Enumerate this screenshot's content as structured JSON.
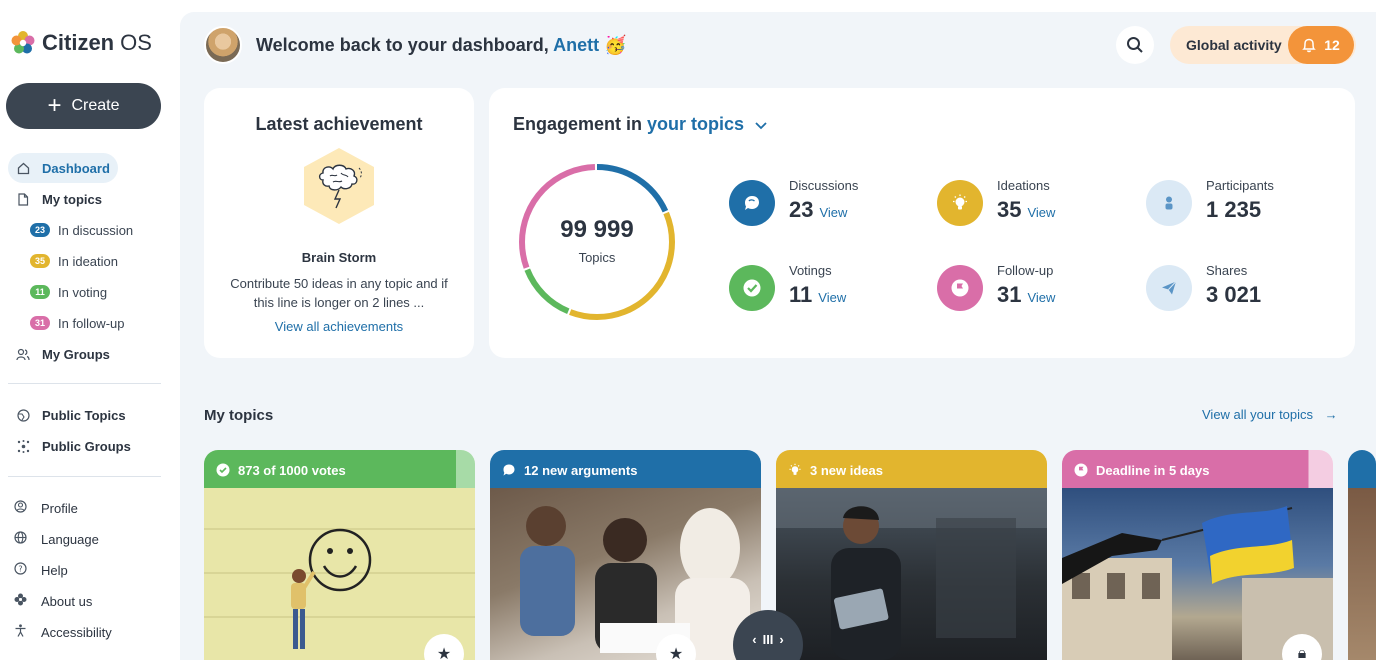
{
  "sidebar": {
    "logo": {
      "brand": "Citizen",
      "suffix": "OS"
    },
    "create_label": "Create",
    "nav": {
      "dashboard": "Dashboard",
      "my_topics": "My topics",
      "in_discussion": {
        "count": "23",
        "label": "In discussion"
      },
      "in_ideation": {
        "count": "35",
        "label": "In ideation"
      },
      "in_voting": {
        "count": "11",
        "label": "In voting"
      },
      "in_followup": {
        "count": "31",
        "label": "In follow-up"
      },
      "my_groups": "My Groups",
      "public_topics": "Public Topics",
      "public_groups": "Public Groups"
    },
    "footer": {
      "profile": "Profile",
      "language": "Language",
      "help": "Help",
      "about": "About us",
      "accessibility": "Accessibility"
    }
  },
  "header": {
    "welcome": "Welcome back to your dashboard,",
    "user_name": "Anett",
    "emoji": "🥳",
    "global_activity": "Global activity",
    "notifications": "12"
  },
  "achievement": {
    "title": "Latest achievement",
    "name": "Brain Storm",
    "description": "Contribute 50 ideas in any topic and if this line is longer on 2 lines ...",
    "link": "View all achievements"
  },
  "engagement": {
    "title_prefix": "Engagement in",
    "title_filter": "your topics",
    "total": "99 999",
    "total_label": "Topics",
    "stats": {
      "discussions": {
        "label": "Discussions",
        "value": "23",
        "link": "View"
      },
      "ideations": {
        "label": "Ideations",
        "value": "35",
        "link": "View"
      },
      "participants": {
        "label": "Participants",
        "value": "1 235"
      },
      "votings": {
        "label": "Votings",
        "value": "11",
        "link": "View"
      },
      "followup": {
        "label": "Follow-up",
        "value": "31",
        "link": "View"
      },
      "shares": {
        "label": "Shares",
        "value": "3 021"
      }
    }
  },
  "my_topics": {
    "title": "My topics",
    "view_all": "View all your topics",
    "cards": [
      {
        "status": "873 of 1000 votes"
      },
      {
        "status": "12 new arguments"
      },
      {
        "status": "3 new ideas"
      },
      {
        "status": "Deadline in 5 days"
      }
    ]
  },
  "colors": {
    "discussion": "#1f6fa8",
    "ideation": "#e2b52e",
    "voting": "#5cb85c",
    "followup": "#d96ea8",
    "accent": "#f3943a"
  }
}
